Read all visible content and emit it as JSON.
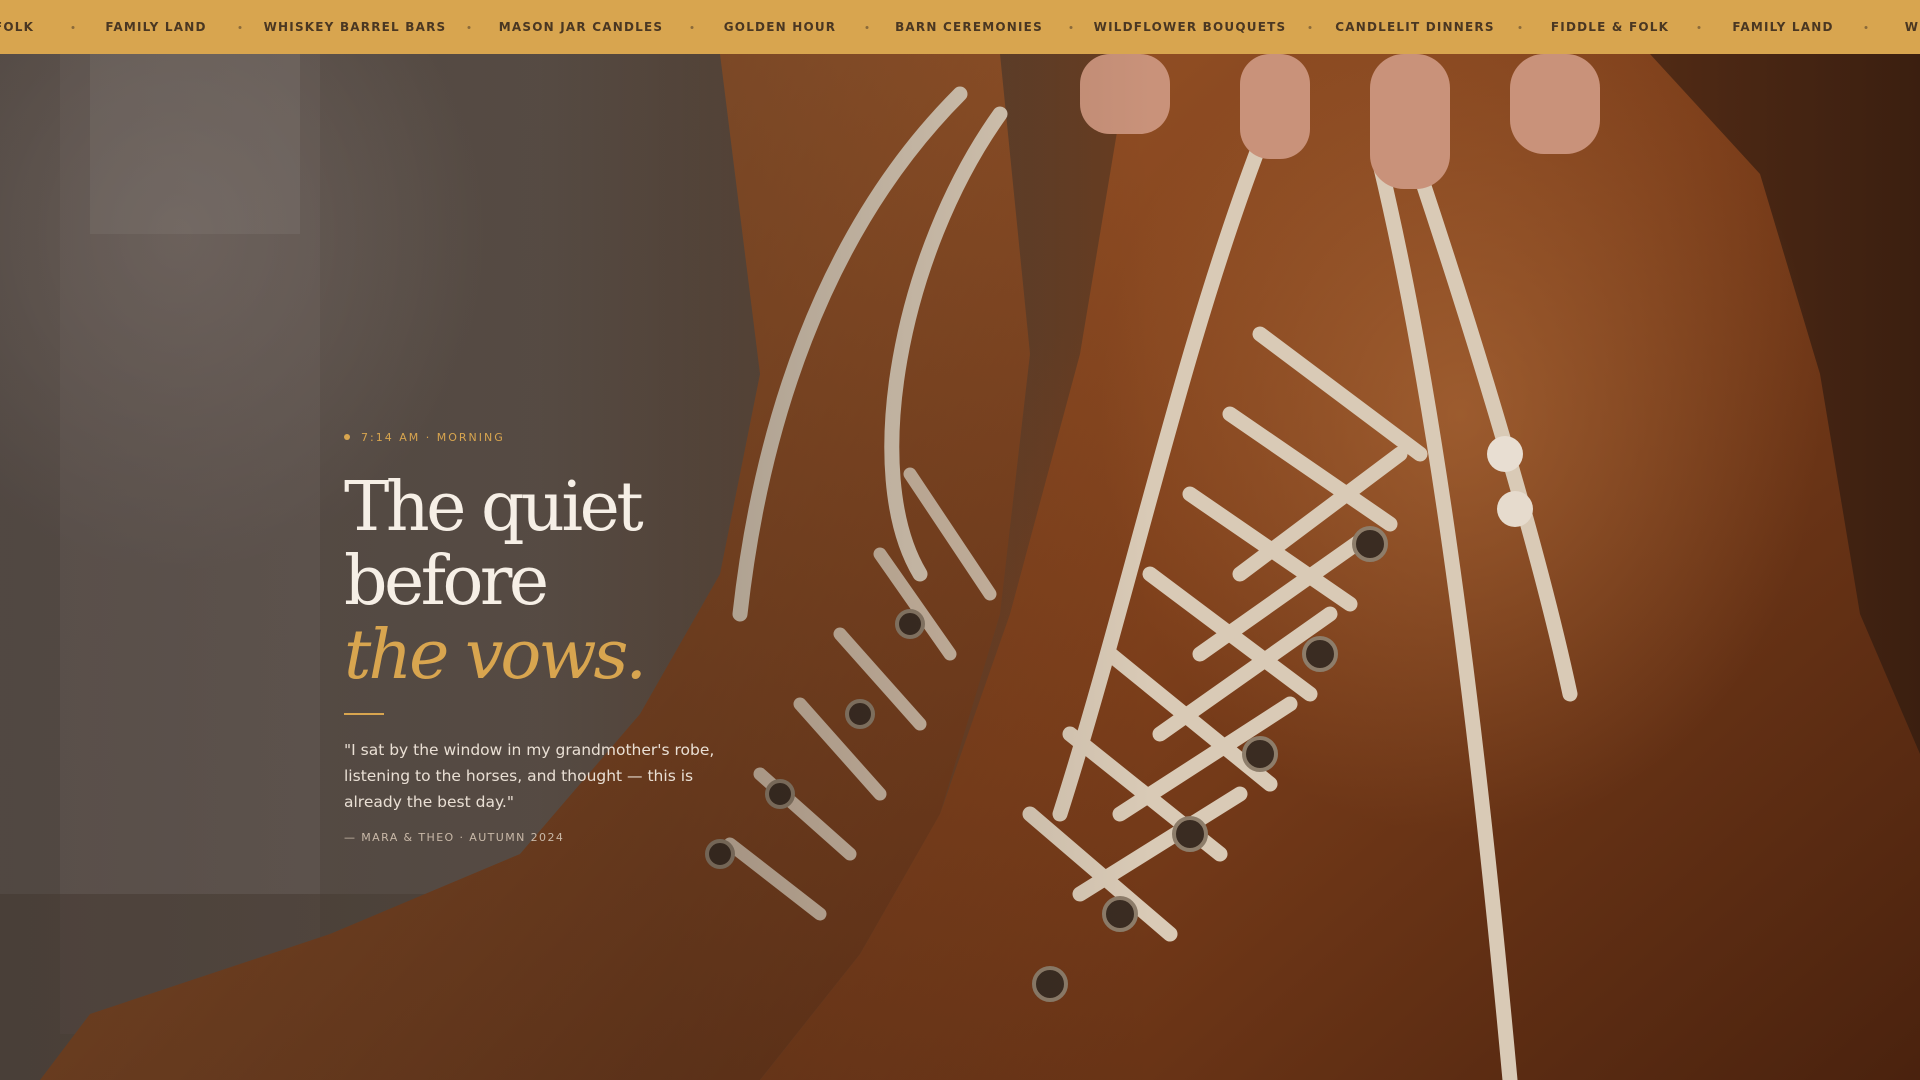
{
  "ticker": {
    "items": [
      "FOLK",
      "FAMILY LAND",
      "WHISKEY BARREL BARS",
      "MASON JAR CANDLES",
      "GOLDEN HOUR",
      "BARN CEREMONIES",
      "WILDFLOWER BOUQUETS",
      "CANDLELIT DINNERS",
      "FIDDLE & FOLK",
      "FAMILY LAND",
      "W"
    ]
  },
  "hero": {
    "image": "laced-leather-boots-photo",
    "eyebrow": "7:14 AM · MORNING",
    "headline_line1": "The quiet before",
    "headline_line2": "the vows.",
    "quote": "\"I sat by the window in my grandmother's robe, listening to the horses, and thought — this is already the best day.\"",
    "attribution": "— MARA & THEO · AUTUMN 2024"
  },
  "colors": {
    "accent": "#d8a54f",
    "ticker_bg": "#d8a54f",
    "ticker_text": "#4a3722",
    "headline": "#f6efe6",
    "body_text": "#e9dfd4"
  }
}
